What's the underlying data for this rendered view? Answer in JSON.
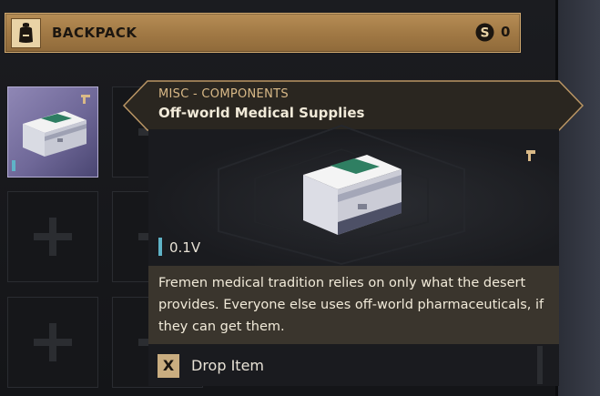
{
  "header": {
    "title": "BACKPACK",
    "currency_icon": "solari-coin-icon",
    "currency_value": "0",
    "icon": "backpack-icon"
  },
  "inventory": {
    "slots": [
      {
        "state": "filled",
        "item": "Off-world Medical Supplies",
        "icon": "medical-crate-icon"
      },
      {
        "state": "empty"
      },
      {
        "state": "empty"
      },
      {
        "state": "empty"
      },
      {
        "state": "empty"
      },
      {
        "state": "empty"
      }
    ]
  },
  "tooltip": {
    "category": "MISC - COMPONENTS",
    "name": "Off-world Medical Supplies",
    "volume": "0.1V",
    "description": "Fremen medical tradition relies on only what the desert provides. Everyone else uses off-world pharmaceuticals, if they can get them.",
    "action_key": "X",
    "action_label": "Drop Item"
  },
  "colors": {
    "accent_gold": "#b68d55",
    "category_text": "#d9b987",
    "durability_teal": "#5fb3c7",
    "slot_rarity_purple": "#7a72a6"
  }
}
